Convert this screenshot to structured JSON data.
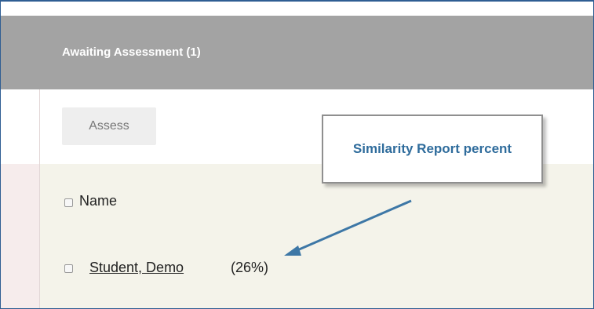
{
  "header": {
    "title": "Awaiting Assessment (1)"
  },
  "toolbar": {
    "assess_label": "Assess"
  },
  "table": {
    "header_label": "Name",
    "rows": [
      {
        "student_name": "Student, Demo",
        "similarity_percent": "(26%)"
      }
    ]
  },
  "callout": {
    "text": "Similarity Report percent"
  },
  "colors": {
    "header_bg": "#a3a3a3",
    "row_bg": "#f4f3ea",
    "callout_text": "#2f6c9c",
    "arrow": "#3d77a6"
  }
}
